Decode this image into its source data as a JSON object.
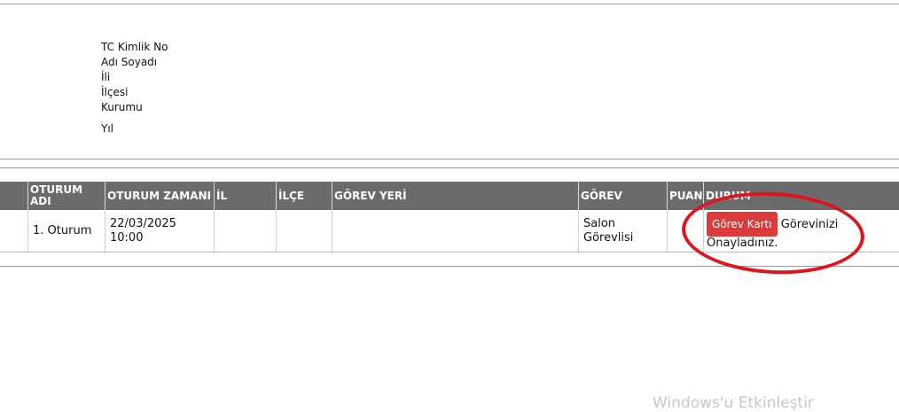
{
  "person_info": {
    "tc_label": "TC Kimlik No",
    "name_label": "Adı Soyadı",
    "province_label": "İli",
    "district_label": "İlçesi",
    "institution_label": "Kurumu",
    "year_label": "Yıl"
  },
  "table": {
    "headers": {
      "oturum_adi": "OTURUM ADI",
      "oturum_zamani": "OTURUM ZAMANI",
      "il": "İL",
      "ilce": "İLÇE",
      "gorev_yeri": "GÖREV YERİ",
      "gorev": "GÖREV",
      "puan": "PUAN",
      "durum": "DURUM"
    },
    "rows": [
      {
        "oturum_adi": "1. Oturum",
        "oturum_zamani_date": "22/03/2025",
        "oturum_zamani_time": "10:00",
        "il": "",
        "ilce": "",
        "gorev_yeri": "",
        "gorev_line1": "Salon",
        "gorev_line2": "Görevlisi",
        "puan": "",
        "durum_button": "Görev Kartı",
        "durum_text": "Görevinizi Onayladınız."
      }
    ]
  },
  "annotation": {
    "highlight_color": "#e0151b"
  },
  "watermark": "Windows'u Etkinleştir"
}
